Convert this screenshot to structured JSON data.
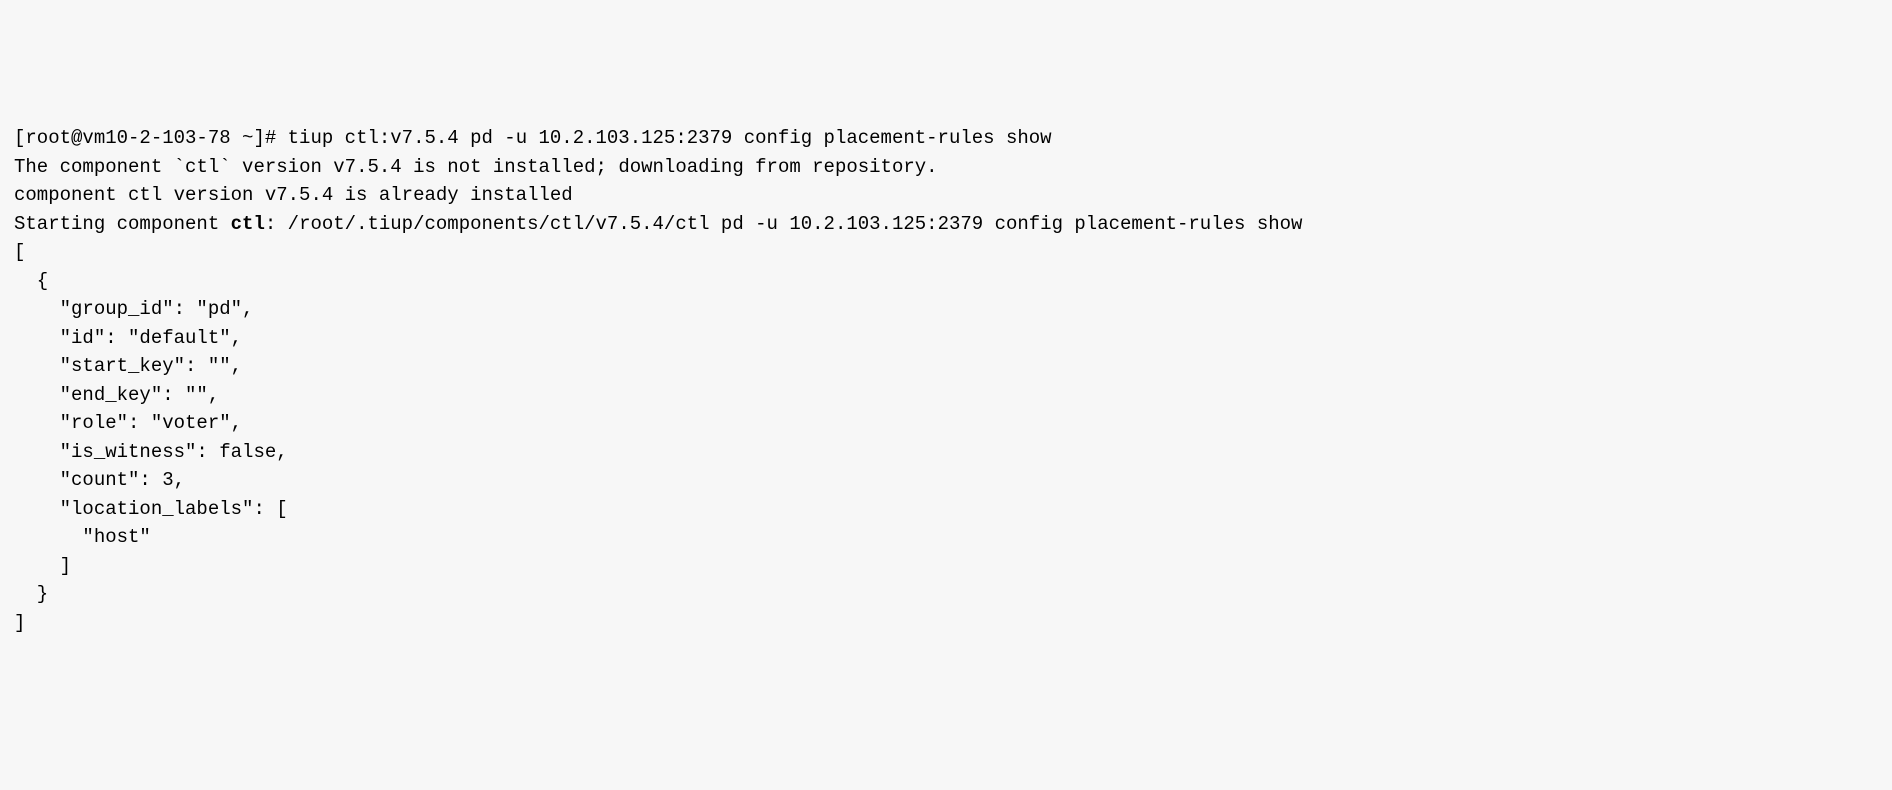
{
  "terminal": {
    "prompt": "[root@vm10-2-103-78 ~]# ",
    "command": "tiup ctl:v7.5.4 pd -u 10.2.103.125:2379 config placement-rules show",
    "msg_not_installed_pre": "The component ",
    "msg_not_installed_code": "`ctl`",
    "msg_not_installed_post": " version v7.5.4 is not installed; downloading from repository.",
    "msg_already_installed": "component ctl version v7.5.4 is already installed",
    "msg_starting_pre": "Starting component ",
    "msg_starting_bold": "ctl",
    "msg_starting_post": ": /root/.tiup/components/ctl/v7.5.4/ctl pd -u 10.2.103.125:2379 config placement-rules show",
    "json_output": "[\n  {\n    \"group_id\": \"pd\",\n    \"id\": \"default\",\n    \"start_key\": \"\",\n    \"end_key\": \"\",\n    \"role\": \"voter\",\n    \"is_witness\": false,\n    \"count\": 3,\n    \"location_labels\": [\n      \"host\"\n    ]\n  }\n]"
  }
}
